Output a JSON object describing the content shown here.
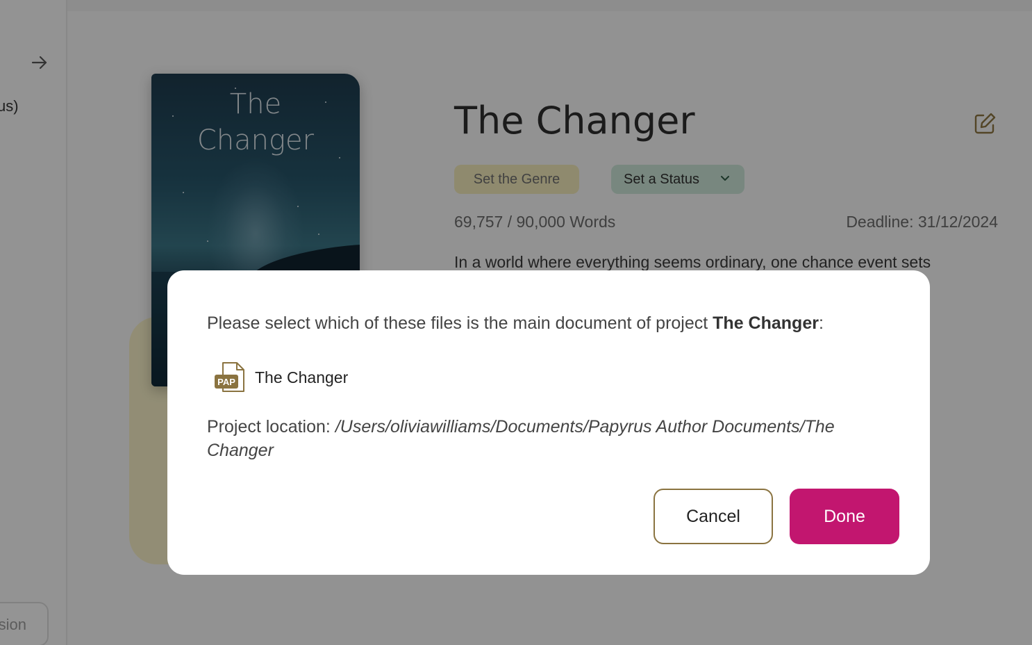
{
  "sidebar": {
    "truncated_label": "us)",
    "version_button_label": "sion"
  },
  "cover": {
    "title_line1": "The",
    "title_line2": "Changer"
  },
  "project": {
    "title": "The Changer",
    "genre_label": "Set the Genre",
    "status_label": "Set a Status",
    "word_count": "69,757 / 90,000 Words",
    "deadline": "Deadline: 31/12/2024",
    "synopsis_start": "In a world where everything seems ordinary, one chance event sets"
  },
  "dialog": {
    "prompt_prefix": "Please select which of these files is the main document of project ",
    "prompt_project": "The Changer",
    "prompt_suffix": ":",
    "file_icon_label": "PAP",
    "file_name": "The Changer",
    "location_label": "Project location: ",
    "location_path": "/Users/oliviawilliams/Documents/Papyrus Author Documents/The Changer",
    "cancel_label": "Cancel",
    "done_label": "Done"
  },
  "colors": {
    "accent": "#c2166f",
    "cancel_border": "#8a7340",
    "genre_bg": "#efe6b8",
    "status_bg": "#c8e2d4",
    "file_icon": "#8a7340"
  },
  "icons": {
    "sidebar_arrow": "arrow-right-icon",
    "edit": "edit-icon",
    "status_dropdown": "chevron-down-icon",
    "file": "pap-file-icon"
  }
}
